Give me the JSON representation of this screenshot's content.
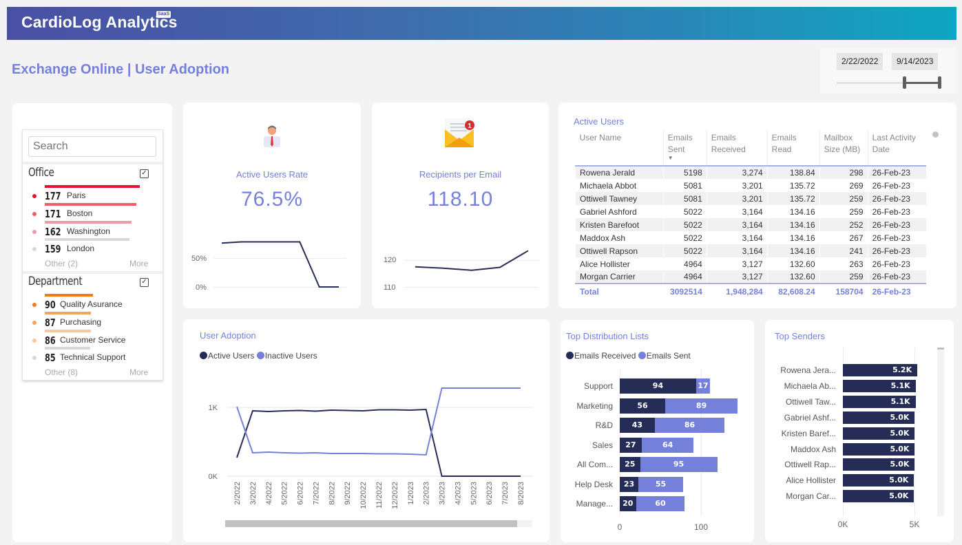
{
  "header": {
    "brand": "CardioLog Analytics",
    "brand_badge": "SaaS",
    "page_title": "Exchange Online | User Adoption"
  },
  "date_filter": {
    "start": "2/22/2022",
    "end": "9/14/2023",
    "range_start_fraction": 0.66,
    "range_end_fraction": 1.0
  },
  "slicer": {
    "search_placeholder": "Search",
    "groups": [
      {
        "title": "Office",
        "items": [
          {
            "count": "177",
            "label": "Paris",
            "color": "#e8112d"
          },
          {
            "count": "171",
            "label": "Boston",
            "color": "#ef5b6e"
          },
          {
            "count": "162",
            "label": "Washington",
            "color": "#f09aa5"
          },
          {
            "count": "159",
            "label": "London",
            "color": "#d9d9d9"
          }
        ],
        "other": "Other (2)",
        "more": "More"
      },
      {
        "title": "Department",
        "items": [
          {
            "count": "90",
            "label": "Quality Asurance",
            "color": "#f77b0f"
          },
          {
            "count": "87",
            "label": "Purchasing",
            "color": "#f5a45c"
          },
          {
            "count": "86",
            "label": "Customer Service",
            "color": "#f6c89a"
          },
          {
            "count": "85",
            "label": "Technical Support",
            "color": "#d9d9d9"
          }
        ],
        "other": "Other (8)",
        "more": "More"
      }
    ]
  },
  "kpis": [
    {
      "title": "Active Users Rate",
      "value": "76.5%",
      "icon": "user-icon",
      "y_ticks": [
        "50%",
        "0%"
      ],
      "trend": [
        0.76,
        0.78,
        0.78,
        0.78,
        0.78,
        0.0,
        0.0
      ]
    },
    {
      "title": "Recipients per Email",
      "value": "118.10",
      "icon": "envelope-icon",
      "badge": "1",
      "y_ticks": [
        "120",
        "110"
      ],
      "trend": [
        117.5,
        117.0,
        116.2,
        117.3,
        123.5
      ]
    }
  ],
  "active_users_table": {
    "title": "Active Users",
    "columns": [
      "User Name",
      "Emails Sent",
      "Emails Received",
      "Emails Read",
      "Mailbox Size (MB)",
      "Last Activity Date"
    ],
    "rows": [
      [
        "Rowena Jerald",
        "5198",
        "3,274",
        "138.84",
        "298",
        "26-Feb-23"
      ],
      [
        "Michaela Abbot",
        "5081",
        "3,201",
        "135.72",
        "269",
        "26-Feb-23"
      ],
      [
        "Ottiwell Tawney",
        "5081",
        "3,201",
        "135.72",
        "259",
        "26-Feb-23"
      ],
      [
        "Gabriel Ashford",
        "5022",
        "3,164",
        "134.16",
        "259",
        "26-Feb-23"
      ],
      [
        "Kristen Barefoot",
        "5022",
        "3,164",
        "134.16",
        "252",
        "26-Feb-23"
      ],
      [
        "Maddox Ash",
        "5022",
        "3,164",
        "134.16",
        "267",
        "26-Feb-23"
      ],
      [
        "Ottiwell Rapson",
        "5022",
        "3,164",
        "134.16",
        "241",
        "26-Feb-23"
      ],
      [
        "Alice Hollister",
        "4964",
        "3,127",
        "132.60",
        "263",
        "26-Feb-23"
      ],
      [
        "Morgan Carrier",
        "4964",
        "3,127",
        "132.60",
        "259",
        "26-Feb-23"
      ]
    ],
    "total": [
      "Total",
      "3092514",
      "1,948,284",
      "82,608.24",
      "158704",
      "26-Feb-23"
    ]
  },
  "chart_data": [
    {
      "type": "line",
      "title": "User Adoption",
      "x": [
        "2/2022",
        "3/2022",
        "4/2022",
        "5/2022",
        "6/2022",
        "7/2022",
        "8/2022",
        "9/2022",
        "10/2022",
        "11/2022",
        "12/2022",
        "1/2023",
        "2/2023",
        "3/2023",
        "4/2023",
        "5/2023",
        "6/2023",
        "7/2023",
        "8/2023"
      ],
      "series": [
        {
          "name": "Active Users",
          "color": "#252c56",
          "values": [
            270,
            950,
            940,
            950,
            955,
            945,
            960,
            955,
            950,
            965,
            965,
            960,
            970,
            0,
            0,
            0,
            0,
            0,
            0
          ]
        },
        {
          "name": "Inactive Users",
          "color": "#7580db",
          "values": [
            1010,
            340,
            350,
            340,
            335,
            340,
            330,
            330,
            330,
            325,
            325,
            320,
            310,
            1280,
            1280,
            1280,
            1280,
            1280,
            1280
          ]
        }
      ],
      "y_ticks": [
        "0K",
        "1K"
      ],
      "ylim": [
        0,
        1400
      ],
      "legend": "top-left",
      "scroll_fraction": 0.95
    },
    {
      "type": "bar",
      "orientation": "horizontal-stacked",
      "title": "Top Distribution Lists",
      "categories": [
        "Support",
        "Marketing",
        "R&D",
        "Sales",
        "All Com...",
        "Help Desk",
        "Manage..."
      ],
      "series": [
        {
          "name": "Emails Received",
          "color": "#252c56",
          "values": [
            94,
            56,
            43,
            27,
            25,
            23,
            20
          ]
        },
        {
          "name": "Emails Sent",
          "color": "#7580db",
          "values": [
            17,
            89,
            86,
            64,
            95,
            55,
            60
          ]
        }
      ],
      "x_ticks": [
        "0",
        "100"
      ],
      "xlim": [
        0,
        145
      ],
      "legend": "top-left"
    },
    {
      "type": "bar",
      "orientation": "horizontal",
      "title": "Top Senders",
      "categories": [
        "Rowena Jera...",
        "Michaela Ab...",
        "Ottiwell Taw...",
        "Gabriel Ashf...",
        "Kristen Baref...",
        "Maddox Ash",
        "Ottiwell Rap...",
        "Alice Hollister",
        "Morgan Car..."
      ],
      "values": [
        5198,
        5081,
        5081,
        5022,
        5022,
        5022,
        5022,
        4964,
        4964
      ],
      "labels": [
        "5.2K",
        "5.1K",
        "5.1K",
        "5.0K",
        "5.0K",
        "5.0K",
        "5.0K",
        "5.0K",
        "5.0K"
      ],
      "color": "#252c56",
      "x_ticks": [
        "0K",
        "5K"
      ],
      "xlim": [
        0,
        6500
      ]
    }
  ]
}
